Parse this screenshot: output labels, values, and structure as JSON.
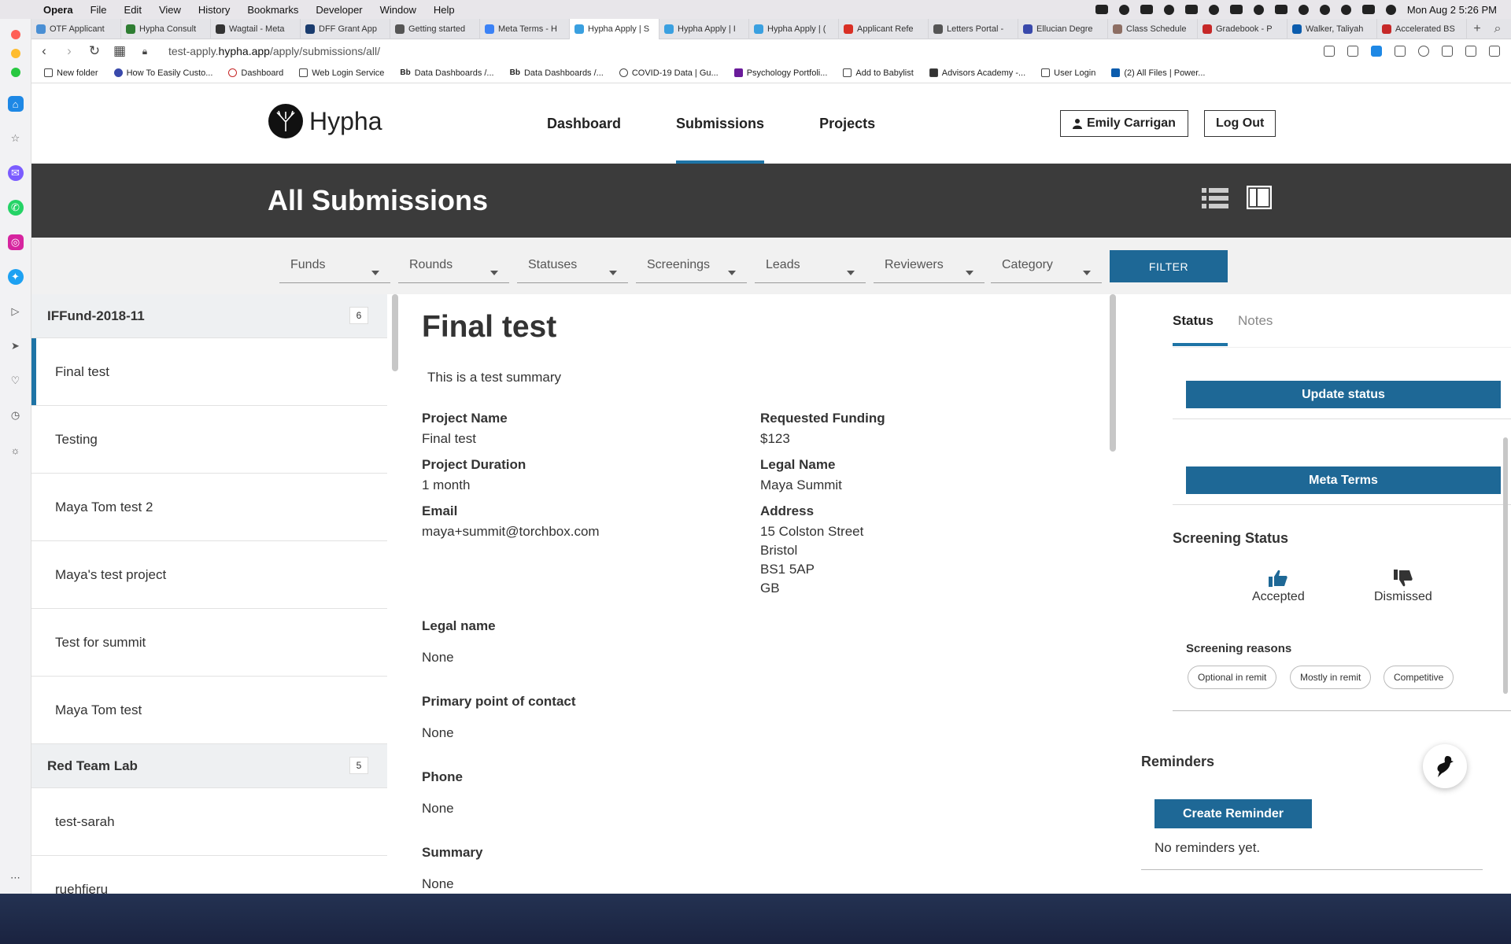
{
  "menubar": {
    "app_name": "Opera",
    "items": [
      "File",
      "Edit",
      "View",
      "History",
      "Bookmarks",
      "Developer",
      "Window",
      "Help"
    ],
    "datetime": "Mon Aug 2  5:26 PM"
  },
  "tabs": [
    {
      "label": "OTF Applicant",
      "color": "#4a8fd4"
    },
    {
      "label": "Hypha Consult",
      "color": "#2e7d32"
    },
    {
      "label": "Wagtail - Meta",
      "color": "#333"
    },
    {
      "label": "DFF Grant App",
      "color": "#1a3c6e"
    },
    {
      "label": "Getting started",
      "color": "#555"
    },
    {
      "label": "Meta Terms - H",
      "color": "#3b82f6"
    },
    {
      "label": "Hypha Apply | S",
      "color": "#3aa0e0",
      "active": true
    },
    {
      "label": "Hypha Apply | I",
      "color": "#3aa0e0"
    },
    {
      "label": "Hypha Apply | (",
      "color": "#3aa0e0"
    },
    {
      "label": "Applicant Refe",
      "color": "#d93025"
    },
    {
      "label": "Letters Portal -",
      "color": "#555"
    },
    {
      "label": "Ellucian Degre",
      "color": "#3949ab"
    },
    {
      "label": "Class Schedule",
      "color": "#8d6e63"
    },
    {
      "label": "Gradebook - P",
      "color": "#c62828"
    },
    {
      "label": "Walker, Taliyah",
      "color": "#0b5cad"
    },
    {
      "label": "Accelerated BS",
      "color": "#c62828"
    }
  ],
  "address": {
    "url_prefix": "test-apply.",
    "url_domain": "hypha.app",
    "url_path": "/apply/submissions/all/"
  },
  "bookmarks": [
    "New folder",
    "How To Easily Custo...",
    "Dashboard",
    "Web Login Service",
    "Data Dashboards /...",
    "Data Dashboards /...",
    "COVID-19 Data | Gu...",
    "Psychology Portfoli...",
    "Add to Babylist",
    "Advisors Academy -...",
    "User Login",
    "(2) All Files | Power..."
  ],
  "site": {
    "logo_text": "Hypha",
    "nav": [
      {
        "label": "Dashboard",
        "active": false
      },
      {
        "label": "Submissions",
        "active": true
      },
      {
        "label": "Projects",
        "active": false
      }
    ],
    "user_name": "Emily Carrigan",
    "logout_label": "Log Out",
    "page_title": "All Submissions"
  },
  "filters": {
    "dropdowns": [
      "Funds",
      "Rounds",
      "Statuses",
      "Screenings",
      "Leads",
      "Reviewers",
      "Category"
    ],
    "button_label": "FILTER"
  },
  "submission_list": {
    "groups": [
      {
        "name": "IFFund-2018-11",
        "count": "6",
        "items": [
          "Final test",
          "Testing",
          "Maya Tom test 2",
          "Maya's test project",
          "Test for summit",
          "Maya Tom test"
        ]
      },
      {
        "name": "Red Team Lab",
        "count": "5",
        "items": [
          "test-sarah",
          "ruehfieru"
        ]
      }
    ]
  },
  "detail": {
    "title": "Final test",
    "summary": "This is a test summary",
    "project_name_label": "Project Name",
    "project_name": "Final test",
    "requested_funding_label": "Requested Funding",
    "requested_funding": "$123",
    "project_duration_label": "Project Duration",
    "project_duration": "1 month",
    "legal_name_label": "Legal Name",
    "legal_name": "Maya Summit",
    "email_label": "Email",
    "email": "maya+summit@torchbox.com",
    "address_label": "Address",
    "address_lines": [
      "15 Colston Street",
      "Bristol",
      "BS1 5AP",
      "GB"
    ],
    "sections": [
      {
        "label": "Legal name",
        "value": "None"
      },
      {
        "label": "Primary point of contact",
        "value": "None"
      },
      {
        "label": "Phone",
        "value": "None"
      },
      {
        "label": "Summary",
        "value": "None"
      }
    ]
  },
  "right_panel": {
    "tabs": [
      "Status",
      "Notes"
    ],
    "update_status_label": "Update status",
    "meta_terms_label": "Meta Terms",
    "screening_status_title": "Screening Status",
    "accepted_label": "Accepted",
    "dismissed_label": "Dismissed",
    "screening_reasons_title": "Screening reasons",
    "reasons": [
      "Optional in remit",
      "Mostly in remit",
      "Competitive"
    ],
    "reminders_title": "Reminders",
    "create_reminder_label": "Create Reminder",
    "no_reminders_text": "No reminders yet."
  },
  "colors": {
    "primary_blue": "#1e6896",
    "accent_blue": "#1e74a6",
    "hero_bg": "#3b3b3b"
  }
}
